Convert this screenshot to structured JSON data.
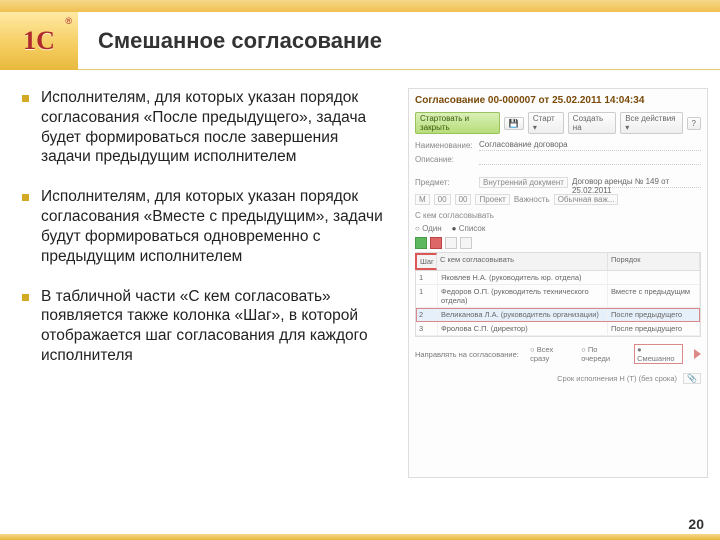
{
  "logo": {
    "text": "1С",
    "r": "®"
  },
  "title": "Смешанное согласование",
  "bullets": [
    "Исполнителям, для которых указан порядок согласования «После предыдущего», задача будет формироваться после завершения задачи предыдущим исполнителем",
    "Исполнителям, для которых указан порядок согласования «Вместе с предыдущим», задачи будут формироваться одновременно с предыдущим исполнителем",
    "В табличной части «С кем согласовать» появляется также колонка «Шаг», в которой отображается шаг согласования для каждого исполнителя"
  ],
  "screenshot": {
    "window_title": "Согласование 00-000007 от 25.02.2011 14:04:34",
    "toolbar": {
      "run_close": "Стартовать и закрыть",
      "save_icon": "💾",
      "start": "Старт ▾",
      "create_from": "Создать на",
      "all_actions": "Все действия ▾",
      "help": "?"
    },
    "fields": {
      "author_label": "Наименование:",
      "author_value": "Согласование договора",
      "desc_label": "Описание:"
    },
    "subject_label": "Предмет:",
    "subject_value": "Внутренний документ",
    "subject_doc": "Договор аренды № 149 от 25.02.2011",
    "control_row": [
      "M",
      "00",
      "00",
      "Проект",
      "Важность",
      "Обычная важ..."
    ],
    "who_label": "С кем согласовывать",
    "radio1": [
      "Один",
      "Список"
    ],
    "table": {
      "headers": {
        "step": "Шаг",
        "who": "С кем согласовывать",
        "order": "Порядок"
      },
      "rows": [
        {
          "step": "1",
          "who": "Яковлев Н.А. (руководитель юр. отдела)",
          "order": ""
        },
        {
          "step": "1",
          "who": "Федоров О.П. (руководитель технического отдела)",
          "order": "Вместе с предыдущим"
        },
        {
          "step": "2",
          "who": "Великанова Л.А. (руководитель организации)",
          "order": "После предыдущего"
        },
        {
          "step": "3",
          "who": "Фролова С.П. (директор)",
          "order": "После предыдущего"
        }
      ]
    },
    "direct_label": "Направлять на согласование:",
    "direct_options": [
      "Всех сразу",
      "По очереди",
      "Смешанно"
    ],
    "footer": {
      "deadline": "Срок исполнения  Н (Т) (без срока)"
    }
  },
  "page_number": "20"
}
